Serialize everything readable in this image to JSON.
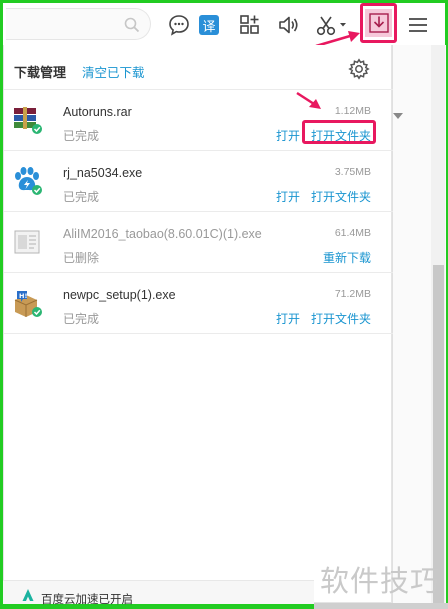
{
  "toolbar": {
    "search_icon": "search-icon",
    "icons": [
      "chat-icon",
      "translate-icon",
      "apps-add-icon",
      "speaker-icon",
      "scissors-icon",
      "download-icon",
      "menu-icon"
    ],
    "translate_label": "译",
    "accent_color": "#e8185f"
  },
  "panel": {
    "title": "下载管理",
    "clear_label": "清空已下载",
    "settings_icon": "gear-icon"
  },
  "downloads": [
    {
      "name": "Autoruns.rar",
      "size": "1.12MB",
      "status": "已完成",
      "open": "打开",
      "open_folder": "打开文件夹",
      "icon": "winrar-icon"
    },
    {
      "name": "rj_na5034.exe",
      "size": "3.75MB",
      "status": "已完成",
      "open": "打开",
      "open_folder": "打开文件夹",
      "icon": "paw-app-icon"
    },
    {
      "name": "AliIM2016_taobao(8.60.01C)(1).exe",
      "size": "61.4MB",
      "status": "已删除",
      "redownload": "重新下载",
      "icon": "generic-file-icon"
    },
    {
      "name": "newpc_setup(1).exe",
      "size": "71.2MB",
      "status": "已完成",
      "open": "打开",
      "open_folder": "打开文件夹",
      "icon": "setup-package-icon"
    }
  ],
  "footer": {
    "text": "百度云加速已开启"
  },
  "watermark": "软件技巧"
}
